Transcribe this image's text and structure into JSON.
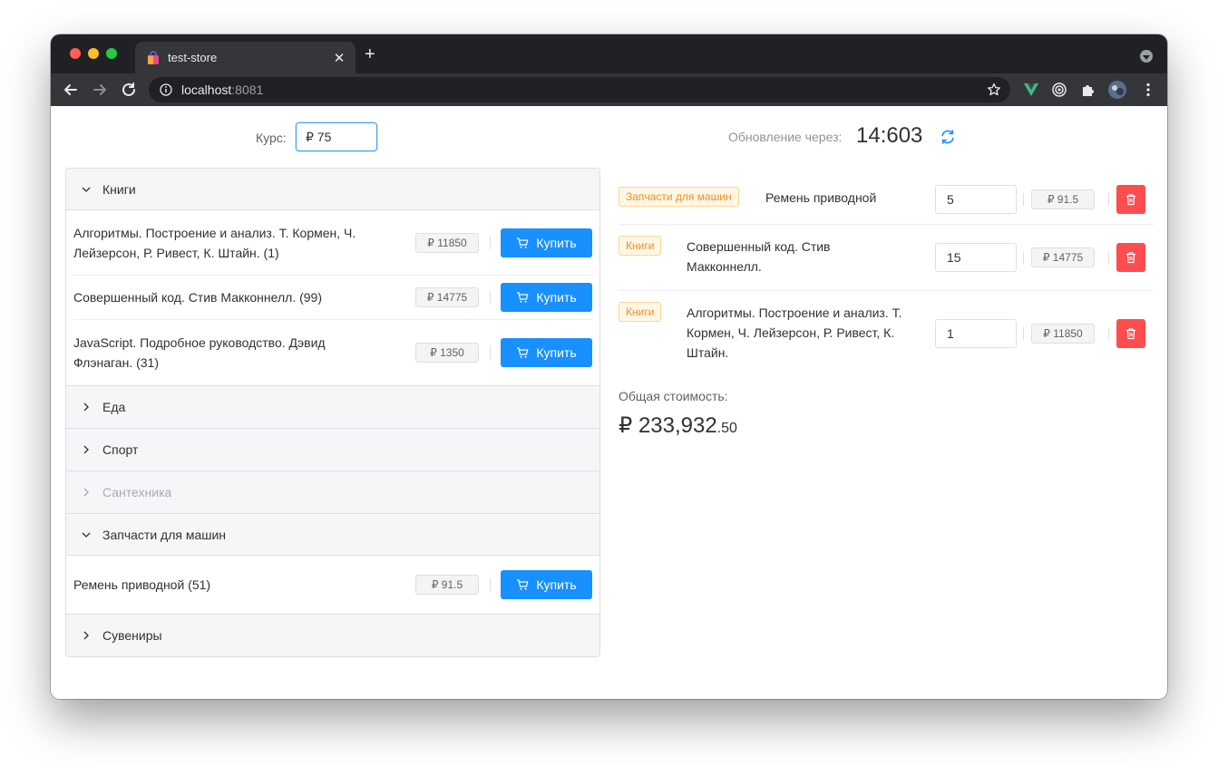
{
  "browser": {
    "tab_title": "test-store",
    "url_host": "localhost",
    "url_port": ":8081"
  },
  "header": {
    "rate_label": "Курс:",
    "rate_value": "₽ 75",
    "update_label": "Обновление через:",
    "update_timer": "14:603"
  },
  "catalog": {
    "groups": [
      {
        "title": "Книги",
        "open": true,
        "items": [
          {
            "name": "Алгоритмы. Построение и анализ. Т. Кормен, Ч. Лейзерсон, Р. Ривест, К. Штайн. (1)",
            "price": "₽ 11850",
            "buy": "Купить"
          },
          {
            "name": "Совершенный код. Стив Макконнелл. (99)",
            "price": "₽ 14775",
            "buy": "Купить"
          },
          {
            "name": "JavaScript. Подробное руководство. Дэвид Флэнаган. (31)",
            "price": "₽ 1350",
            "buy": "Купить"
          }
        ]
      },
      {
        "title": "Еда",
        "open": false
      },
      {
        "title": "Спорт",
        "open": false
      },
      {
        "title": "Сантехника",
        "open": false,
        "disabled": true
      },
      {
        "title": "Запчасти для машин",
        "open": true,
        "items": [
          {
            "name": "Ремень приводной (51)",
            "price": "₽ 91.5",
            "buy": "Купить"
          }
        ]
      },
      {
        "title": "Сувениры",
        "open": false
      }
    ]
  },
  "cart": {
    "items": [
      {
        "category": "Запчасти для машин",
        "name": "Ремень приводной",
        "qty": "5",
        "price": "₽ 91.5"
      },
      {
        "category": "Книги",
        "name": "Совершенный код. Стив Макконнелл.",
        "qty": "15",
        "price": "₽ 14775"
      },
      {
        "category": "Книги",
        "name": "Алгоритмы. Построение и анализ. Т. Кормен, Ч. Лейзерсон, Р. Ривест, К. Штайн.",
        "qty": "1",
        "price": "₽ 11850"
      }
    ],
    "total_label": "Общая стоимость:",
    "total_main": "₽ 233,932",
    "total_cents": ".50"
  },
  "colors": {
    "primary": "#1890ff",
    "danger": "#ff4d4f",
    "tag_orange": "#fa8c16",
    "refresh": "#1890ff"
  }
}
